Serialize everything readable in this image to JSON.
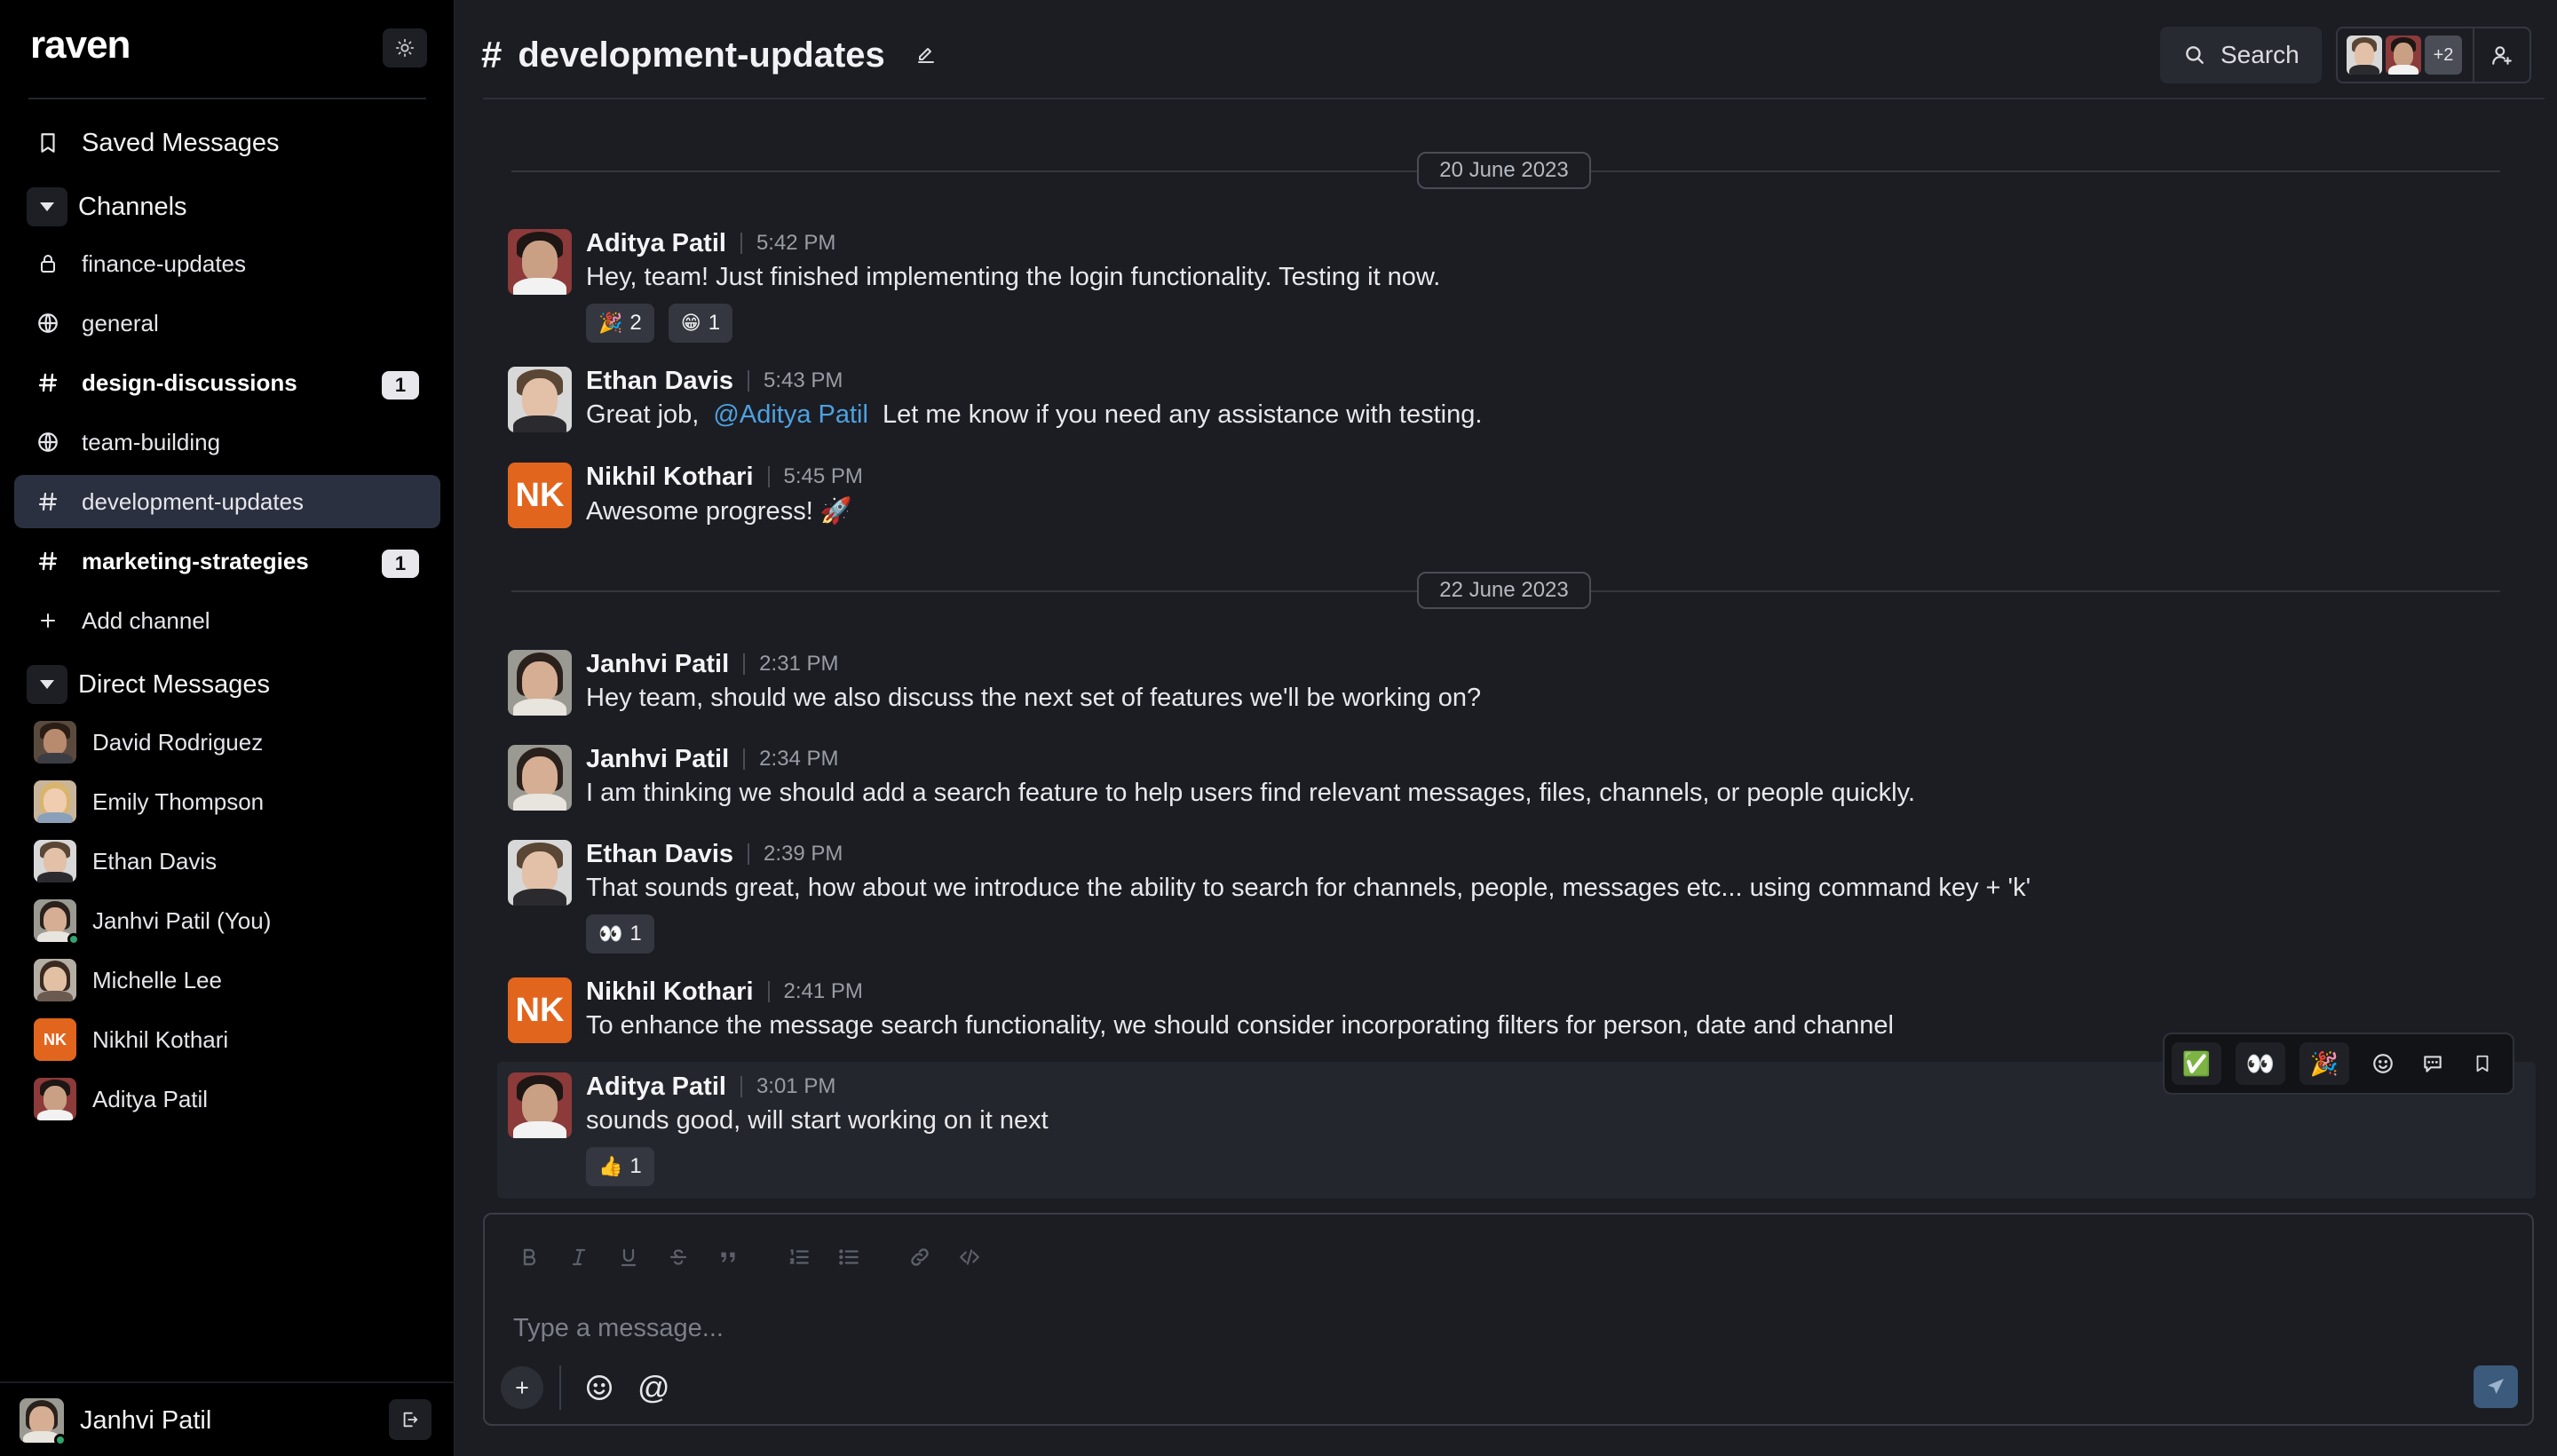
{
  "app": {
    "logo": "raven"
  },
  "sidebar": {
    "saved_messages": "Saved Messages",
    "channels_header": "Channels",
    "channels": [
      {
        "label": "finance-updates",
        "icon": "lock-icon",
        "unread": null
      },
      {
        "label": "general",
        "icon": "globe-icon",
        "unread": null
      },
      {
        "label": "design-discussions",
        "icon": "hash-icon",
        "unread": "1"
      },
      {
        "label": "team-building",
        "icon": "globe-icon",
        "unread": null
      },
      {
        "label": "development-updates",
        "icon": "hash-icon",
        "unread": null
      },
      {
        "label": "marketing-strategies",
        "icon": "hash-icon",
        "unread": "1"
      }
    ],
    "add_channel": "Add channel",
    "dm_header": "Direct Messages",
    "dms": [
      {
        "label": "David Rodriguez"
      },
      {
        "label": "Emily Thompson"
      },
      {
        "label": "Ethan Davis"
      },
      {
        "label": "Janhvi Patil (You)"
      },
      {
        "label": "Michelle Lee"
      },
      {
        "label": "Nikhil Kothari",
        "initials": "NK"
      },
      {
        "label": "Aditya Patil"
      }
    ],
    "current_user": "Janhvi Patil"
  },
  "channel": {
    "hash": "#",
    "name": "development-updates",
    "search_label": "Search",
    "members_more": "+2"
  },
  "dates": [
    "20 June 2023",
    "22 June 2023"
  ],
  "messages": [
    {
      "name": "Aditya Patil",
      "time": "5:42 PM",
      "text": "Hey, team! Just finished implementing the login functionality. Testing it now.",
      "reactions": [
        {
          "emoji": "🎉",
          "count": "2"
        },
        {
          "emoji": "😁",
          "count": "1"
        }
      ]
    },
    {
      "name": "Ethan Davis",
      "time": "5:43 PM",
      "text_before": "Great job,",
      "mention": "@Aditya Patil",
      "text_after": "Let me know if you need any assistance with testing."
    },
    {
      "name": "Nikhil Kothari",
      "initials": "NK",
      "time": "5:45 PM",
      "text": "Awesome progress! 🚀"
    },
    {
      "name": "Janhvi Patil",
      "time": "2:31 PM",
      "text": "Hey team, should we also discuss the next set of features we'll be working on?"
    },
    {
      "name": "Janhvi Patil",
      "time": "2:34 PM",
      "text": "I am thinking we should add a search feature to help users find relevant messages, files, channels, or people quickly."
    },
    {
      "name": "Ethan Davis",
      "time": "2:39 PM",
      "text": "That sounds great, how about we introduce the ability to search for channels, people, messages etc... using command key + 'k'",
      "reactions": [
        {
          "emoji": "👀",
          "count": "1"
        }
      ]
    },
    {
      "name": "Nikhil Kothari",
      "initials": "NK",
      "time": "2:41 PM",
      "text": "To enhance the message search functionality, we should consider incorporating filters for person, date and channel"
    },
    {
      "name": "Aditya Patil",
      "time": "3:01 PM",
      "text": "sounds good, will start working on it next",
      "reactions": [
        {
          "emoji": "👍",
          "count": "1"
        }
      ]
    }
  ],
  "message_actions": {
    "quick_reactions": [
      "✅",
      "👀",
      "🎉"
    ]
  },
  "composer": {
    "placeholder": "Type a message...",
    "mention_symbol": "@"
  },
  "colors": {
    "active_channel_bg": "#2b3040",
    "mention": "#4ea1e0",
    "initials_bg": "#e2651e",
    "online": "#30a46c",
    "send_button": "#3b5a7c"
  }
}
